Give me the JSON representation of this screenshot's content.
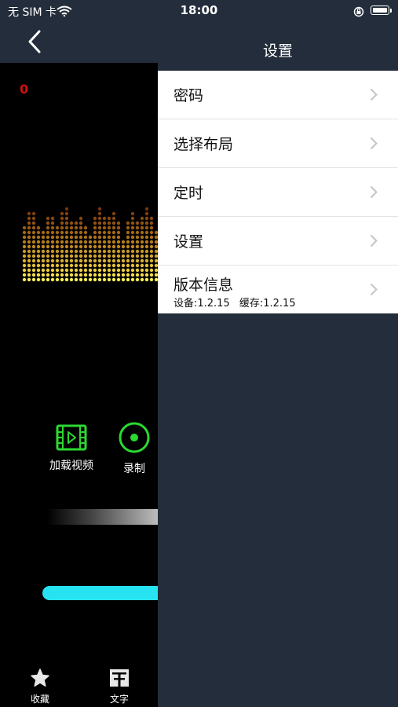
{
  "status_bar": {
    "carrier": "无 SIM 卡",
    "time": "18:00"
  },
  "nav": {
    "title": "设置"
  },
  "player": {
    "counter": "0",
    "tools": {
      "load_video": "加载视频",
      "record": "录制"
    },
    "tabs": {
      "favorites": "收藏",
      "text": "文字"
    }
  },
  "settings": {
    "items": [
      {
        "label": "密码"
      },
      {
        "label": "选择布局"
      },
      {
        "label": "定时"
      },
      {
        "label": "设置"
      },
      {
        "label": "版本信息",
        "device_version": "设备:1.2.15",
        "cache_version": "缓存:1.2.15"
      }
    ]
  },
  "colors": {
    "nav_background": "#232d3b",
    "accent_green": "#2bd931",
    "slider_cyan": "#27e3f2",
    "counter_red": "#d01010"
  }
}
